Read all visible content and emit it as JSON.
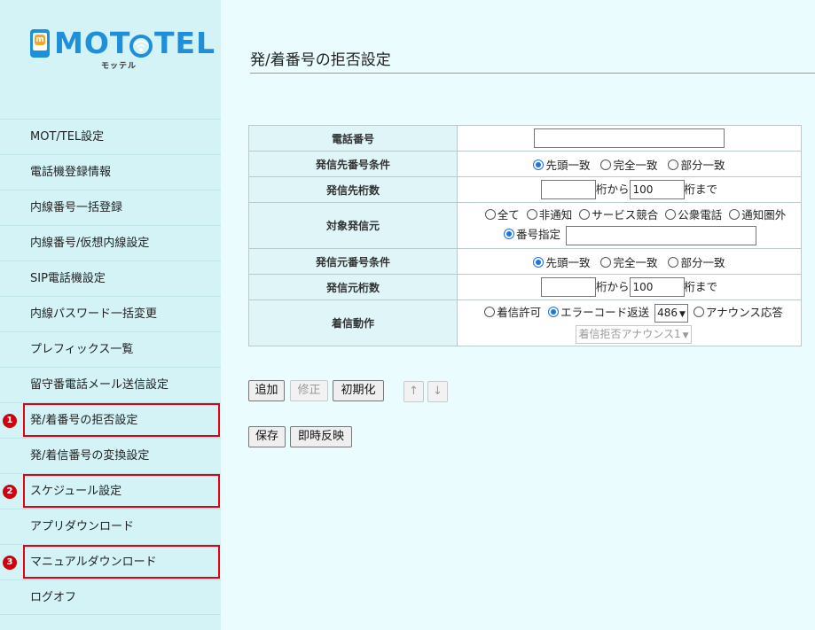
{
  "logo": {
    "brand_left": "MOT",
    "brand_right": "TEL",
    "subtitle": "モッテル",
    "icon": "phone-m-icon",
    "wifi_icon": "wifi-icon"
  },
  "sidebar": {
    "items": [
      {
        "label": "MOT/TEL設定"
      },
      {
        "label": "電話機登録情報"
      },
      {
        "label": "内線番号一括登録"
      },
      {
        "label": "内線番号/仮想内線設定"
      },
      {
        "label": "SIP電話機設定"
      },
      {
        "label": "内線パスワード一括変更"
      },
      {
        "label": "プレフィックス一覧"
      },
      {
        "label": "留守番電話メール送信設定"
      },
      {
        "label": "発/着番号の拒否設定",
        "badge": "1"
      },
      {
        "label": "発/着信番号の変換設定"
      },
      {
        "label": "スケジュール設定",
        "badge": "2"
      },
      {
        "label": "アプリダウンロード"
      },
      {
        "label": "マニュアルダウンロード",
        "badge": "3"
      },
      {
        "label": "ログオフ"
      }
    ],
    "highlight_color": "#e60012"
  },
  "page": {
    "title": "発/着番号の拒否設定"
  },
  "form": {
    "phone_number": {
      "label": "電話番号",
      "value": ""
    },
    "caller_condition": {
      "label": "発信先番号条件",
      "options": [
        "先頭一致",
        "完全一致",
        "部分一致"
      ],
      "selected": 0
    },
    "caller_digits": {
      "label": "発信先桁数",
      "from_value": "",
      "from_suffix": "桁から",
      "to_value": "100",
      "to_suffix": "桁まで"
    },
    "target_source": {
      "label": "対象発信元",
      "options": [
        "全て",
        "非通知",
        "サービス競合",
        "公衆電話",
        "通知圏外"
      ],
      "specify_label": "番号指定",
      "specify_value": ""
    },
    "source_condition": {
      "label": "発信元番号条件",
      "options": [
        "先頭一致",
        "完全一致",
        "部分一致"
      ],
      "selected": 0
    },
    "source_digits": {
      "label": "発信元桁数",
      "from_value": "",
      "from_suffix": "桁から",
      "to_value": "100",
      "to_suffix": "桁まで"
    },
    "incoming_action": {
      "label": "着信動作",
      "allow": "着信許可",
      "error": "エラーコード返送",
      "error_code": "486",
      "announce": "アナウンス応答",
      "announce_select": "着信拒否アナウンス1"
    }
  },
  "buttons": {
    "add": "追加",
    "edit": "修正",
    "reset": "初期化",
    "up": "↑",
    "down": "↓",
    "save": "保存",
    "apply": "即時反映"
  }
}
